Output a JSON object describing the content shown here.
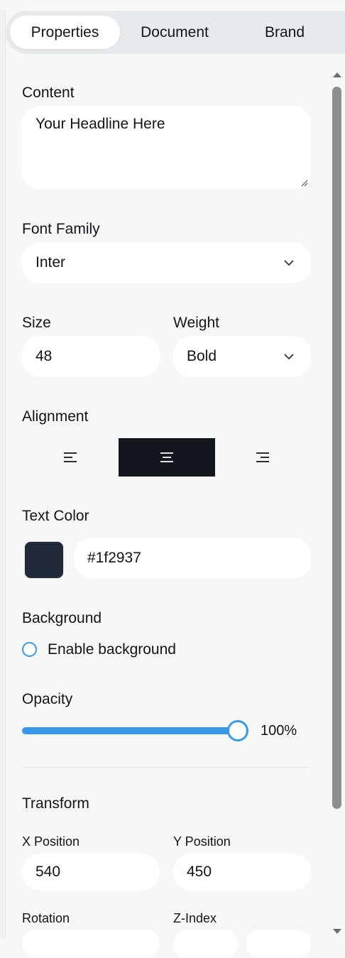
{
  "tabs": [
    {
      "label": "Properties",
      "active": true
    },
    {
      "label": "Document",
      "active": false
    },
    {
      "label": "Brand",
      "active": false
    }
  ],
  "content": {
    "label": "Content",
    "value": "Your Headline Here"
  },
  "font_family": {
    "label": "Font Family",
    "value": "Inter"
  },
  "size": {
    "label": "Size",
    "value": "48"
  },
  "weight": {
    "label": "Weight",
    "value": "Bold"
  },
  "alignment": {
    "label": "Alignment",
    "options": [
      "left",
      "center",
      "right"
    ],
    "selected": "center"
  },
  "text_color": {
    "label": "Text Color",
    "value": "#1f2937",
    "swatch": "#1f2937"
  },
  "background": {
    "label": "Background",
    "checkbox_label": "Enable background",
    "enabled": false
  },
  "opacity": {
    "label": "Opacity",
    "value": 1.0,
    "value_label": "100%"
  },
  "transform": {
    "label": "Transform",
    "x_position": {
      "label": "X Position",
      "value": "540"
    },
    "y_position": {
      "label": "Y Position",
      "value": "450"
    },
    "rotation": {
      "label": "Rotation"
    },
    "z_index": {
      "label": "Z-Index"
    }
  },
  "colors": {
    "accent": "#3a97e6",
    "active_button": "#10161b"
  }
}
